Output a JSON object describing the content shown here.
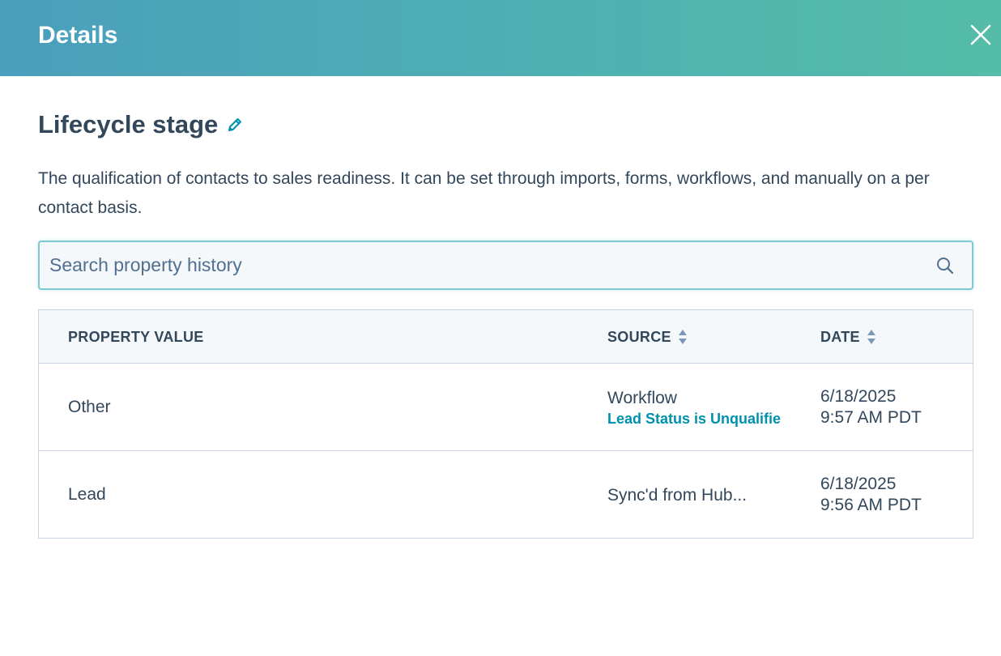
{
  "header": {
    "title": "Details"
  },
  "property": {
    "title": "Lifecycle stage",
    "description": "The qualification of contacts to sales readiness. It can be set through imports, forms, workflows, and manually on a per contact basis."
  },
  "search": {
    "value": "",
    "placeholder": "Search property history"
  },
  "table": {
    "columns": {
      "value": "PROPERTY VALUE",
      "source": "SOURCE",
      "date": "DATE"
    },
    "rows": [
      {
        "value": "Other",
        "source": "Workflow",
        "source_link": "Lead Status is Unqualifie",
        "date": "6/18/2025",
        "time": "9:57 AM PDT"
      },
      {
        "value": "Lead",
        "source": "Sync'd from Hub...",
        "source_link": "",
        "date": "6/18/2025",
        "time": "9:56 AM PDT"
      }
    ]
  },
  "colors": {
    "header_gradient_start": "#4a9fbc",
    "header_gradient_end": "#55bca8",
    "text": "#33475b",
    "link": "#0091ae",
    "edit_icon": "#0091ae",
    "search_border": "#81c8d3"
  },
  "icons": {
    "close": "close-icon",
    "edit": "pencil-icon",
    "search": "search-icon",
    "sort": "sort-icon"
  }
}
